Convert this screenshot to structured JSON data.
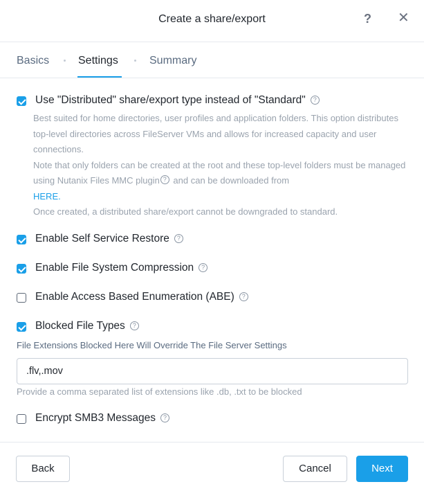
{
  "header": {
    "title": "Create a share/export",
    "help_label": "?",
    "close_label": "✕"
  },
  "tabs": [
    {
      "label": "Basics"
    },
    {
      "label": "Settings"
    },
    {
      "label": "Summary"
    }
  ],
  "options": {
    "distributed": {
      "label": "Use \"Distributed\" share/export type instead of \"Standard\"",
      "checked": true,
      "desc1": "Best suited for home directories, user profiles and application folders. This option distributes top-level directories across FileServer VMs and allows for increased capacity and user connections.",
      "desc2_a": "Note that only folders can be created at the root and these top-level folders must be managed using Nutanix Files MMC plugin",
      "desc2_b": " and can be downloaded from",
      "desc2_link": "HERE.",
      "desc3": "Once created, a distributed share/export cannot be downgraded to standard."
    },
    "self_service_restore": {
      "label": "Enable Self Service Restore",
      "checked": true
    },
    "compression": {
      "label": "Enable File System Compression",
      "checked": true
    },
    "abe": {
      "label": "Enable Access Based Enumeration (ABE)",
      "checked": false
    },
    "blocked_file_types": {
      "label": "Blocked File Types",
      "checked": true,
      "sublabel": "File Extensions Blocked Here Will Override The File Server Settings",
      "value": ".flv,.mov",
      "hint": "Provide a comma separated list of extensions like .db, .txt to be blocked"
    },
    "smb3_encrypt": {
      "label": "Encrypt SMB3 Messages",
      "checked": false
    }
  },
  "help_icon": "?",
  "footer": {
    "back_label": "Back",
    "cancel_label": "Cancel",
    "next_label": "Next"
  },
  "colors": {
    "accent": "#1a9fe8",
    "text": "#22272e",
    "muted": "#9aa3ae"
  }
}
